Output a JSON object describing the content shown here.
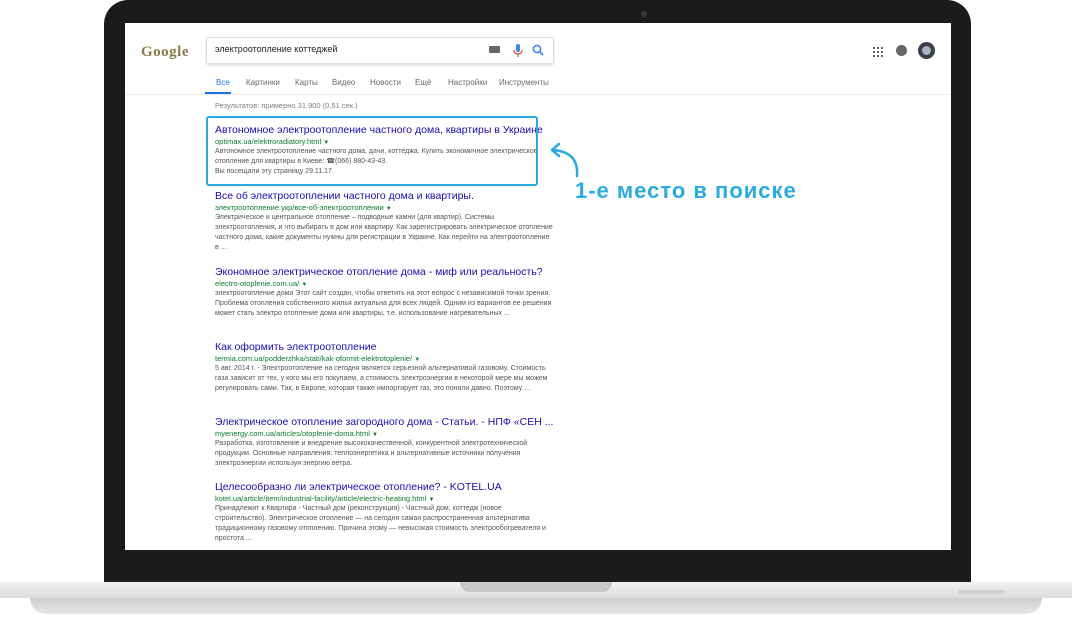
{
  "search": {
    "query": "электроотопление коттеджей"
  },
  "logo": {
    "text": "Google"
  },
  "tabs": [
    {
      "label": "Все"
    },
    {
      "label": "Картинки"
    },
    {
      "label": "Карты"
    },
    {
      "label": "Видео"
    },
    {
      "label": "Новости"
    },
    {
      "label": "Ещё"
    },
    {
      "label": "Настройки"
    },
    {
      "label": "Инструменты"
    }
  ],
  "stats": "Результатов: примерно 31 900 (0,51 сек.)",
  "results": [
    {
      "title": "Автономное электроотопление частного дома, квартиры в Украине",
      "url": "optimax.ua/elektroradiatory.html",
      "snippet": "Автономное электроотопление частного дома, дачи, коттеджа. Купить экономичное электрическое отопление для квартиры в Киеве: ☎(066) 880-43-43.",
      "visited": "Вы посещали эту страницу 29.11.17."
    },
    {
      "title": "Все об электроотоплении частного дома и квартиры.",
      "url": "электроотопление.укр/все-об-электроотоплении",
      "snippet": "Электрическое и центральное отопление – подводные камни (для квартир). Системы электроотопления, и что выбирать в дом или квартиру. Как зарегистрировать электрическое отопление частного дома, какие документы нужны для регистрации в Украине. Как перейти на электроотопление в ..."
    },
    {
      "title": "Экономное электрическое отопление дома - миф или реальность?",
      "url": "electro-otoplenie.com.ua/",
      "snippet": "электроотопление дома Этот сайт создан, чтобы ответить на этот вопрос с независимой точки зрения. Проблема отопления собственного жилья актуальна для всех людей. Одним из вариантов ее решения может стать электро отопление дома или квартиры, т.е. использование нагревательных ..."
    },
    {
      "title": "Как оформить электроотопление",
      "url": "termia.com.ua/podderzhka/stati/kak-oformit-elektrotoplenie/",
      "snippet": "5 авг. 2014 г. - Электроотопление на сегодня является серьезной альтернативой газовому. Стоимость газа зависит от тех, у кого мы его покупаем, а стоимость электроэнергии в некоторой мере мы можем регулировать сами. Так, в Европе, которая также импортирует газ, это поняли давно. Поэтому ..."
    },
    {
      "title": "Электрическое отопление загородного дома - Статьи. - НПФ «СЕН ...",
      "url": "myenergy.com.ua/articles/otoplenie-doma.html",
      "snippet": "Разработка, изготовление и внедрение высококачественной, конкурентной электротехнической продукции. Основные направления: теплоэнергетика и альтернативные источники получения электроэнергии используя энергию ветра."
    },
    {
      "title": "Целесообразно ли электрическое отопление? - KOTEL.UA",
      "url": "kotel.ua/article/item/industrial-facility/article/electric-heating.html",
      "snippet": "Принадлежит к Квартира - Частный дом (реконструкция) - Частный дом, коттедж (новое строительство). Электрическое отопление — на сегодня самая распространенная альтернатива традиционному газовому отоплению. Причина этому — невысокая стоимость электрообогревателя и простота ..."
    }
  ],
  "annotation": "1-е место в поиске",
  "colors": {
    "accent": "#29abe2",
    "link": "#1a0dab",
    "url": "#0a7d2c"
  }
}
